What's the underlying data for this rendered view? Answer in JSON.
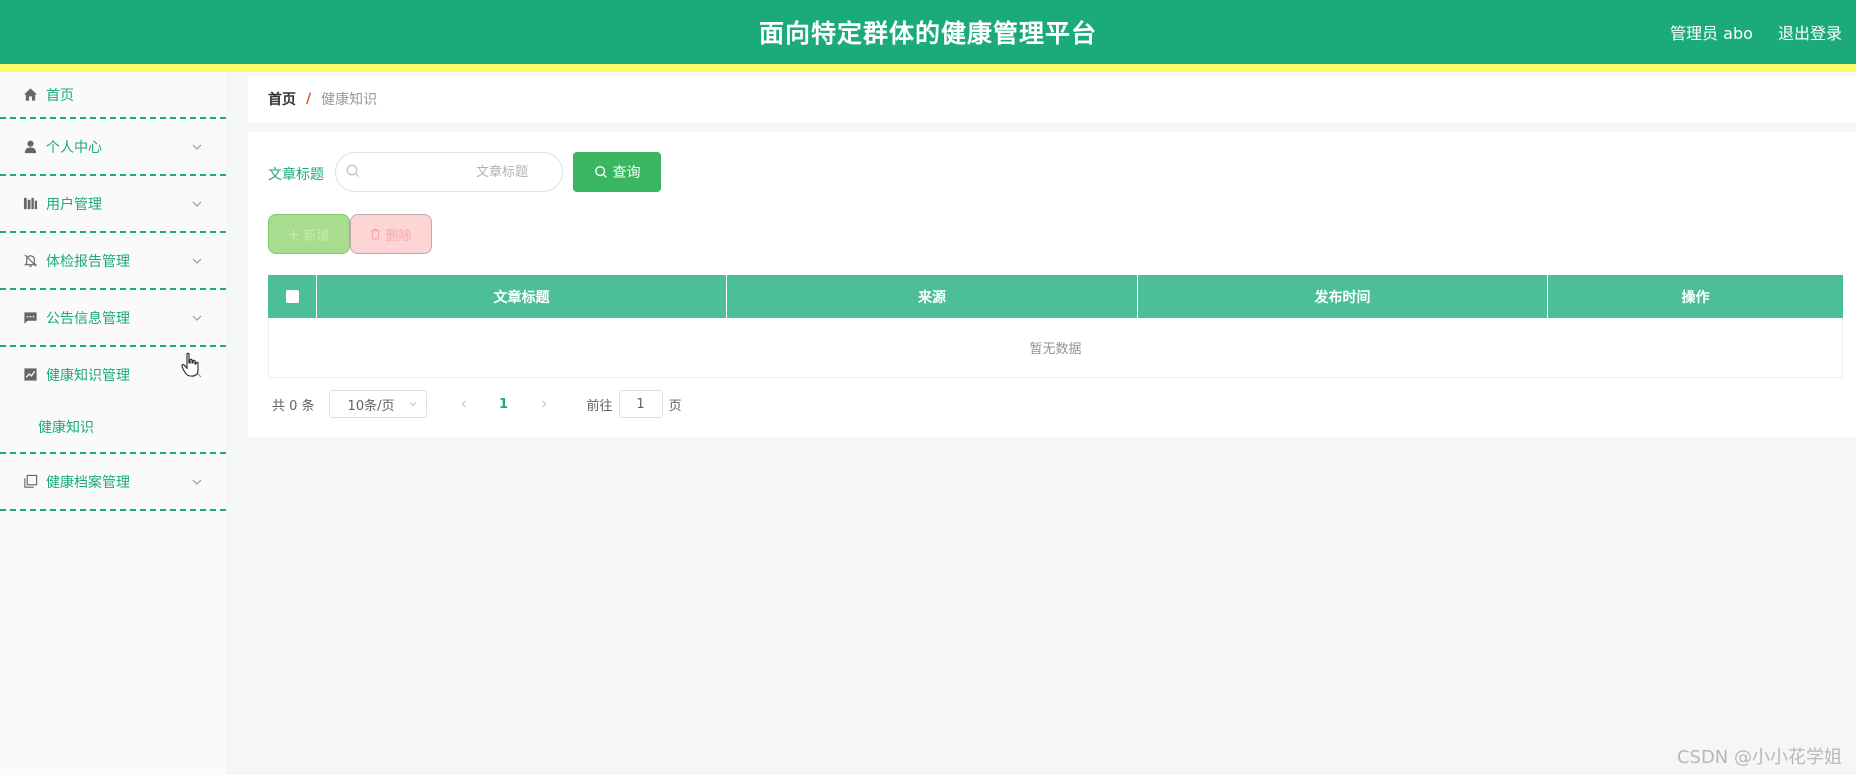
{
  "header": {
    "title": "面向特定群体的健康管理平台",
    "user_label": "管理员 abo",
    "logout_label": "退出登录"
  },
  "sidebar": {
    "items": [
      {
        "label": "首页",
        "icon": "home-icon"
      },
      {
        "label": "个人中心",
        "icon": "user-icon"
      },
      {
        "label": "用户管理",
        "icon": "library-icon"
      },
      {
        "label": "体检报告管理",
        "icon": "bell-off-icon"
      },
      {
        "label": "公告信息管理",
        "icon": "message-icon"
      },
      {
        "label": "健康知识管理",
        "icon": "chart-icon",
        "expanded": true,
        "children": [
          {
            "label": "健康知识"
          }
        ]
      },
      {
        "label": "健康档案管理",
        "icon": "copy-icon"
      }
    ]
  },
  "breadcrumb": {
    "home": "首页",
    "separator": "/",
    "current": "健康知识"
  },
  "search": {
    "label": "文章标题",
    "placeholder": "文章标题",
    "button_label": "查询"
  },
  "actions": {
    "add_label": "新增",
    "delete_label": "删除"
  },
  "table": {
    "columns": [
      "文章标题",
      "来源",
      "发布时间",
      "操作"
    ],
    "empty_text": "暂无数据"
  },
  "pagination": {
    "total_text": "共 0 条",
    "page_size": "10条/页",
    "current_page": "1",
    "goto_prefix": "前往",
    "goto_value": "1",
    "goto_suffix": "页"
  },
  "watermark": "CSDN @小小花学姐",
  "colors": {
    "primary": "#1baa7a",
    "stripe": "#fdfb6b",
    "table_header": "#4cbf96",
    "query_button": "#3bb660"
  }
}
